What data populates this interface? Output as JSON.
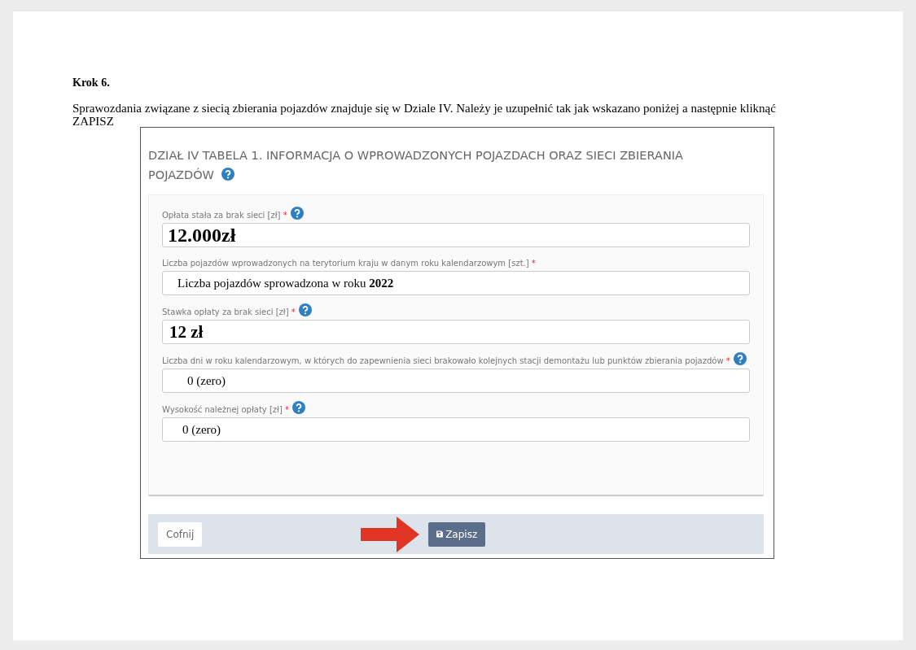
{
  "document": {
    "heading": "Krok 6.",
    "paragraph": "Sprawozdania związane z siecią zbierania pojazdów znajduje się w Dziale IV. Należy je uzupełnić tak jak wskazano poniżej a następnie kliknąć ZAPISZ"
  },
  "form": {
    "title": "DZIAŁ IV TABELA 1. INFORMACJA O WPROWADZONYCH POJAZDACH ORAZ SIECI ZBIERANIA POJAZDÓW",
    "title_help": true,
    "fields": [
      {
        "label": "Opłata stała za brak sieci [zł]",
        "required_mark": "*",
        "help": true,
        "value": "12.000zł",
        "kind": "large"
      },
      {
        "label": "Liczba pojazdów wprowadzonych na terytorium kraju w danym roku kalendarzowym [szt.]",
        "required_mark": "*",
        "value": "Liczba pojazdów sprowadzona w roku **2022**",
        "kind": "mixed"
      },
      {
        "label": "Stawka opłaty za brak sieci [zł]",
        "required_mark": "*",
        "help": true,
        "value": "12 zł",
        "kind": "medium"
      },
      {
        "label": "Liczba dni w roku kalendarzowym, w których do zapewnienia sieci brakowało kolejnych stacji demontażu lub punktów zbierania pojazdów",
        "required_mark": "*",
        "help": true,
        "value": "0 (zero)",
        "kind": "plain"
      },
      {
        "label": "Wysokość należnej opłaty [zł]",
        "required_mark": "*",
        "help": true,
        "value": "0 (zero)",
        "kind": "plain"
      }
    ],
    "buttons": [
      {
        "label": "Cofnij",
        "kind": "secondary"
      },
      {
        "label": "Zapisz",
        "kind": "primary"
      }
    ]
  }
}
